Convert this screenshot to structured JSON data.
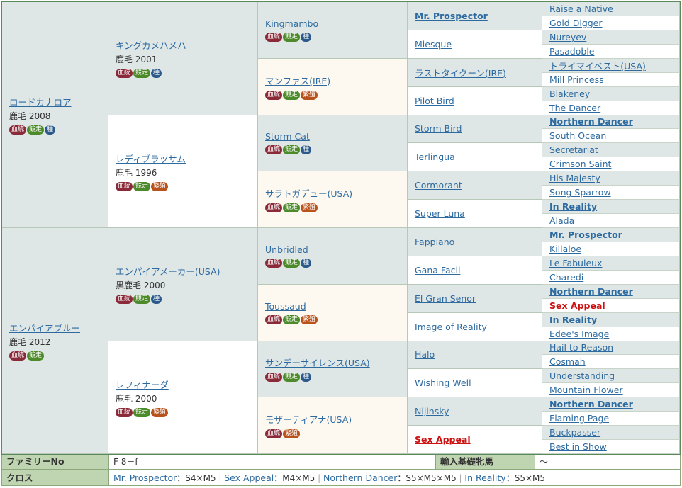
{
  "gen1": [
    {
      "name": "ロードカナロア",
      "info": "鹿毛 2008",
      "badges": [
        "血統",
        "競走",
        "種"
      ]
    },
    {
      "name": "エンパイアブルー",
      "info": "鹿毛 2012",
      "badges": [
        "血統",
        "競走"
      ]
    }
  ],
  "gen2": [
    {
      "name": "キングカメハメハ",
      "info": "鹿毛 2001",
      "badges": [
        "血統",
        "競走",
        "種"
      ]
    },
    {
      "name": "レディブラッサム",
      "info": "鹿毛 1996",
      "badges": [
        "血統",
        "競走",
        "繁殖"
      ]
    },
    {
      "name": "エンパイアメーカー(USA)",
      "info": "黒鹿毛 2000",
      "badges": [
        "血統",
        "競走",
        "種"
      ]
    },
    {
      "name": "レフィナーダ",
      "info": "鹿毛 2000",
      "badges": [
        "血統",
        "競走",
        "繁殖"
      ]
    }
  ],
  "gen3": [
    {
      "name": "Kingmambo",
      "badges": [
        "血統",
        "競走",
        "種"
      ]
    },
    {
      "name": "マンファス(IRE)",
      "badges": [
        "血統",
        "競走",
        "繁殖"
      ]
    },
    {
      "name": "Storm Cat",
      "badges": [
        "血統",
        "競走",
        "種"
      ]
    },
    {
      "name": "サラトガデュー(USA)",
      "badges": [
        "血統",
        "競走",
        "繁殖"
      ]
    },
    {
      "name": "Unbridled",
      "badges": [
        "血統",
        "競走",
        "種"
      ]
    },
    {
      "name": "Toussaud",
      "badges": [
        "血統",
        "競走",
        "繁殖"
      ]
    },
    {
      "name": "サンデーサイレンス(USA)",
      "badges": [
        "血統",
        "競走",
        "種"
      ]
    },
    {
      "name": "モザーティアナ(USA)",
      "badges": [
        "血統",
        "繁殖"
      ]
    }
  ],
  "gen4": [
    {
      "name": "Mr. Prospector",
      "style": "b"
    },
    {
      "name": "Miesque",
      "style": ""
    },
    {
      "name": "ラストタイクーン(IRE)",
      "style": ""
    },
    {
      "name": "Pilot Bird",
      "style": ""
    },
    {
      "name": "Storm Bird",
      "style": ""
    },
    {
      "name": "Terlingua",
      "style": ""
    },
    {
      "name": "Cormorant",
      "style": ""
    },
    {
      "name": "Super Luna",
      "style": ""
    },
    {
      "name": "Fappiano",
      "style": ""
    },
    {
      "name": "Gana Facil",
      "style": ""
    },
    {
      "name": "El Gran Senor",
      "style": ""
    },
    {
      "name": "Image of Reality",
      "style": ""
    },
    {
      "name": "Halo",
      "style": ""
    },
    {
      "name": "Wishing Well",
      "style": ""
    },
    {
      "name": "Nijinsky",
      "style": ""
    },
    {
      "name": "Sex Appeal",
      "style": "r"
    }
  ],
  "gen5": [
    {
      "name": "Raise a Native",
      "style": ""
    },
    {
      "name": "Gold Digger",
      "style": ""
    },
    {
      "name": "Nureyev",
      "style": ""
    },
    {
      "name": "Pasadoble",
      "style": ""
    },
    {
      "name": "トライマイベスト(USA)",
      "style": ""
    },
    {
      "name": "Mill Princess",
      "style": ""
    },
    {
      "name": "Blakeney",
      "style": ""
    },
    {
      "name": "The Dancer",
      "style": ""
    },
    {
      "name": "Northern Dancer",
      "style": "b"
    },
    {
      "name": "South Ocean",
      "style": ""
    },
    {
      "name": "Secretariat",
      "style": ""
    },
    {
      "name": "Crimson Saint",
      "style": ""
    },
    {
      "name": "His Majesty",
      "style": ""
    },
    {
      "name": "Song Sparrow",
      "style": ""
    },
    {
      "name": "In Reality",
      "style": "b"
    },
    {
      "name": "Alada",
      "style": ""
    },
    {
      "name": "Mr. Prospector",
      "style": "b"
    },
    {
      "name": "Killaloe",
      "style": ""
    },
    {
      "name": "Le Fabuleux",
      "style": ""
    },
    {
      "name": "Charedi",
      "style": ""
    },
    {
      "name": "Northern Dancer",
      "style": "b"
    },
    {
      "name": "Sex Appeal",
      "style": "r"
    },
    {
      "name": "In Reality",
      "style": "b"
    },
    {
      "name": "Edee's Image",
      "style": ""
    },
    {
      "name": "Hail to Reason",
      "style": ""
    },
    {
      "name": "Cosmah",
      "style": ""
    },
    {
      "name": "Understanding",
      "style": ""
    },
    {
      "name": "Mountain Flower",
      "style": ""
    },
    {
      "name": "Northern Dancer",
      "style": "b"
    },
    {
      "name": "Flaming Page",
      "style": ""
    },
    {
      "name": "Buckpasser",
      "style": ""
    },
    {
      "name": "Best in Show",
      "style": ""
    }
  ],
  "footer": {
    "family_label": "ファミリーNo",
    "family_value": "F 8－f",
    "import_label": "輸入基礎牝馬",
    "import_value": "～",
    "cross_label": "クロス",
    "crosses": [
      {
        "name": "Mr. Prospector",
        "value": "：S4×M5"
      },
      {
        "name": "Sex Appeal",
        "value": "：M4×M5"
      },
      {
        "name": "Northern Dancer",
        "value": "：S5×M5×M5"
      },
      {
        "name": "In Reality",
        "value": "：S5×M5"
      }
    ]
  },
  "colors": {
    "blood": "#8b2b3a",
    "race": "#4c8a2a",
    "stud": "#2b5a8a",
    "broodmare": "#b8531e"
  }
}
